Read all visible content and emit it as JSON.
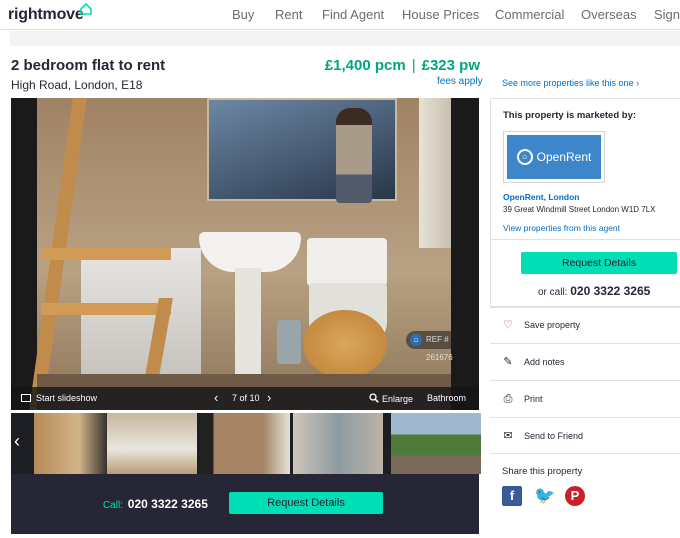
{
  "header": {
    "logo": "rightmove",
    "nav": [
      "Buy",
      "Rent",
      "Find Agent",
      "House Prices",
      "Commercial",
      "Overseas",
      "Sign"
    ]
  },
  "listing": {
    "title": "2 bedroom flat to rent",
    "address": "High Road, London, E18",
    "price_pcm": "£1,400 pcm",
    "price_pw": "£323 pw",
    "fees": "fees apply"
  },
  "gallery": {
    "ref": "REF # 261676",
    "slideshow": "Start slideshow",
    "counter": "7 of 10",
    "enlarge": "Enlarge",
    "label": "Bathroom"
  },
  "cta": {
    "call_label": "Call:",
    "phone": "020 3322 3265",
    "request": "Request Details"
  },
  "sidebar": {
    "see_more": "See more properties like this one",
    "marketed_by": "This property is marketed by:",
    "agent_logo_text": "OpenRent",
    "agent_name": "OpenRent, London",
    "agent_address": "39 Great Windmill Street London W1D 7LX",
    "view_properties": "View properties from this agent",
    "request": "Request Details",
    "or_call": "or call:",
    "phone": "020 3322 3265",
    "actions": [
      {
        "label": "Save property",
        "icon": "heart-icon"
      },
      {
        "label": "Add notes",
        "icon": "pencil-icon"
      },
      {
        "label": "Print",
        "icon": "printer-icon"
      },
      {
        "label": "Send to Friend",
        "icon": "envelope-icon"
      }
    ],
    "share_title": "Share this property"
  },
  "colors": {
    "accent": "#00deb6",
    "price": "#00a67e",
    "link": "#0070c9",
    "dark": "#262637"
  }
}
